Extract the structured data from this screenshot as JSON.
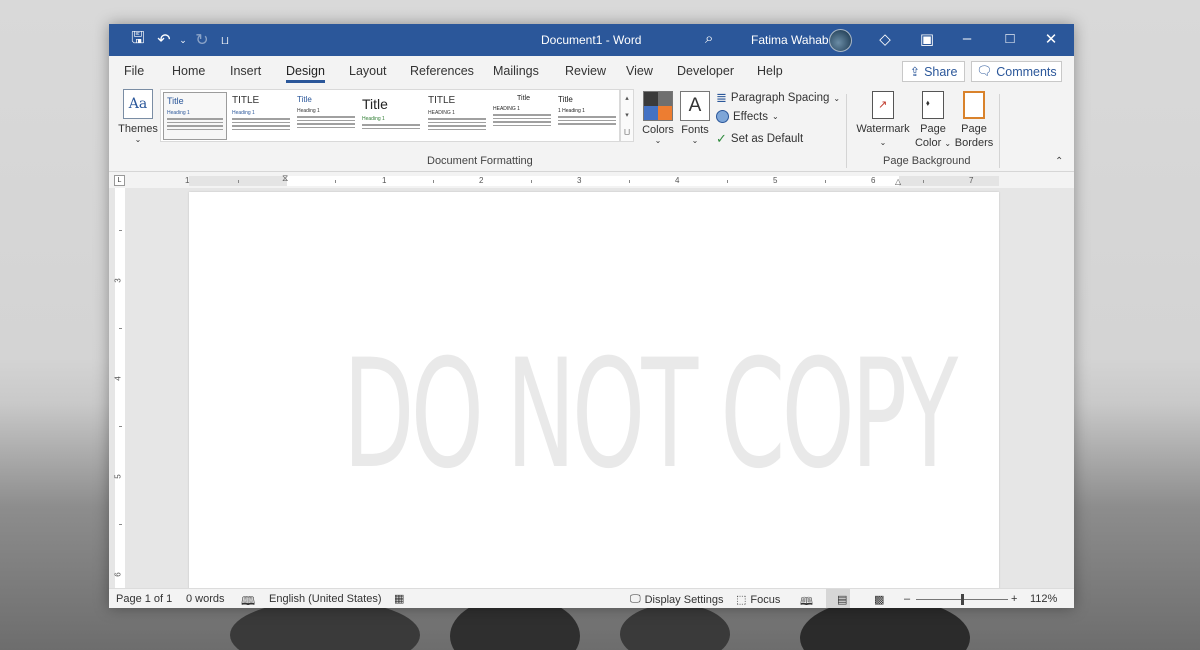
{
  "titlebar": {
    "title": "Document1  -  Word",
    "user": "Fatima Wahab",
    "icons": [
      "save-icon",
      "undo-icon",
      "redo-icon",
      "customize-qat-icon",
      "search-icon",
      "diamond-icon",
      "ribbon-display-icon",
      "minimize-icon",
      "maximize-icon",
      "close-icon"
    ]
  },
  "menu": {
    "tabs": [
      "File",
      "Home",
      "Insert",
      "Design",
      "Layout",
      "References",
      "Mailings",
      "Review",
      "View",
      "Developer",
      "Help"
    ],
    "active": "Design",
    "share": "Share",
    "comments": "Comments"
  },
  "ribbon": {
    "themes_label": "Themes",
    "themes_tile": "Aa",
    "style_set": [
      {
        "title": "Title",
        "heading": "Heading 1"
      },
      {
        "title": "TITLE",
        "heading": "Heading 1"
      },
      {
        "title": "Title",
        "heading": "Heading 1"
      },
      {
        "title": "Title",
        "heading": "Heading 1"
      },
      {
        "title": "TITLE",
        "heading": "HEADING 1"
      },
      {
        "title": "Title",
        "heading": "HEADING 1"
      },
      {
        "title": "Title",
        "heading": "1  Heading 1"
      }
    ],
    "colors_label": "Colors",
    "fonts_label": "Fonts",
    "fonts_tile": "A",
    "paragraph_spacing": "Paragraph Spacing",
    "effects": "Effects",
    "set_default": "Set as Default",
    "group_document_formatting": "Document Formatting",
    "watermark": "Watermark",
    "page_color_1": "Page",
    "page_color_2": "Color",
    "page_borders_1": "Page",
    "page_borders_2": "Borders",
    "group_page_background": "Page Background",
    "swatch_colors": [
      "#3b3b3b",
      "#6f6f6f",
      "#4472c4",
      "#ed7d31"
    ]
  },
  "ruler": {
    "h_marks": [
      "1",
      "1",
      "2",
      "3",
      "4",
      "5",
      "6",
      "7"
    ],
    "v_marks": [
      "3",
      "4",
      "5",
      "6"
    ]
  },
  "document": {
    "watermark": "DO NOT COPY"
  },
  "status": {
    "page": "Page 1 of 1",
    "words": "0 words",
    "language": "English (United States)",
    "display_settings": "Display Settings",
    "focus": "Focus",
    "zoom": "112%"
  }
}
